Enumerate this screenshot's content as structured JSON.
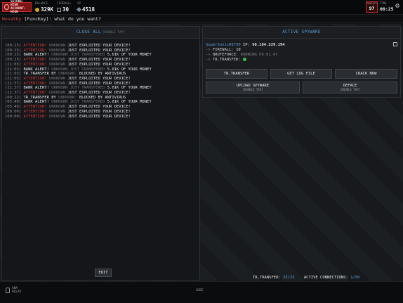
{
  "topbar": {
    "secure_line1": "SECURE: HIGH",
    "secure_line2": "ACCOUNT: HIGH",
    "balance_label": "BALANCE",
    "balance_value": "329K",
    "firewall_label": "FIREWALL",
    "firewall_value": "30",
    "xp_label": "XP",
    "xp_value": "4518",
    "credits_label": "CREDITS",
    "credits_value": "97",
    "time_label": "TIME",
    "time_value": "00:25"
  },
  "chat": {
    "user": "NovaSky",
    "handle": "[FuncKey]:",
    "message": "what do you want?"
  },
  "log_panel": {
    "title": "CLOSE ALL",
    "title_sub": "[DOUBLE TAP]",
    "lines": [
      {
        "t": "[00:25]",
        "a": "ATTENTION!",
        "g": "UNKNOWN",
        "w": "JUST EXPLOITED YOUR DEVICE!"
      },
      {
        "t": "[00:25]",
        "a": "ATTENTION!",
        "g": "UNKNOWN",
        "w": "JUST EXPLOITED YOUR DEVICE!"
      },
      {
        "t": "[00:25]",
        "w": "BANK ALERT!",
        "g": "UNKNOWN JUST TRANSFERED",
        "w2": "5.61K OF YOUR MONEY"
      },
      {
        "t": "[00:25]",
        "a": "ATTENTION!",
        "g": "UNKNOWN",
        "w": "JUST EXPLOITED YOUR DEVICE!"
      },
      {
        "t": "[21:03]",
        "a": "ATTENTION!",
        "g": "UNKNOWN",
        "w": "JUST EXPLOITED YOUR DEVICE!"
      },
      {
        "t": "[21:03]",
        "w": "BANK ALERT!",
        "g": "UNKNOWN JUST TRANSFERED",
        "w2": "5.01K OF YOUR MONEY"
      },
      {
        "t": "[21:03]",
        "w": "TR.TRANSFER BY",
        "g": "UNKNOWN:",
        "w2": "BLOCKED BY ANTIVIRUS"
      },
      {
        "t": "[21:03]",
        "a": "ATTENTION!",
        "g": "UNKNOWN",
        "w": "JUST EXPLOITED YOUR DEVICE!"
      },
      {
        "t": "[11:37]",
        "a": "ATTENTION!",
        "g": "UNKNOWN",
        "w": "JUST EXPLOITED YOUR DEVICE!"
      },
      {
        "t": "[11:37]",
        "w": "BANK ALERT!",
        "g": "UNKNOWN JUST TRANSFERED",
        "w2": "5.01K OF YOUR MONEY"
      },
      {
        "t": "[11:37]",
        "a": "ATTENTION!",
        "g": "UNKNOWN",
        "w": "JUST EXPLOITED YOUR DEVICE!"
      },
      {
        "t": "[09:22]",
        "w": "TR.TRANSFER BY",
        "g": "UNKNOWN:",
        "w2": "BLOCKED BY ANTIVIRUS"
      },
      {
        "t": "[05:40]",
        "w": "BANK ALERT!",
        "g": "UNKNOWN JUST TRANSFERED",
        "w2": "5.01K OF YOUR MONEY"
      },
      {
        "t": "[05:40]",
        "a": "ATTENTION!",
        "g": "UNKNOWN",
        "w": "JUST EXPLOITED YOUR DEVICE!"
      },
      {
        "t": "[00:00]",
        "a": "ATTENTION!",
        "g": "UNKNOWN",
        "w": "JUST EXPLOITED YOUR DEVICE!"
      },
      {
        "t": "[00:00]",
        "a": "ATTENTION!",
        "g": "UNKNOWN",
        "w": "JUST EXPLOITED YOUR DEVICE!"
      }
    ],
    "edit_label": "EDIT"
  },
  "spyware_panel": {
    "title": "ACTIVE SPYWARE",
    "user": "SuperSonic#3730",
    "ip_label": "IP:",
    "ip_value": "98.184.229.194",
    "firewall_key": "FIREWALL:",
    "firewall_val": "10",
    "bruteforce_key": "BRUTEFORCE:",
    "bruteforce_val": "RUNNING 00:01:47",
    "trtransfer_key": "TR.TRANSFER:",
    "buttons": {
      "tr_transfer": "TR.TRANSFER",
      "get_log": "GET LOG FILE",
      "crack": "CRACK NOW",
      "upload": "UPLOAD SPYWARE",
      "upload_sub": "[DOUBLE TAP]",
      "deface": "DEFACE",
      "deface_sub": "[DOUBLE TAP]"
    }
  },
  "status": {
    "tr_label": "TR.TRANSFER:",
    "tr_value": "25/25",
    "conn_label": "ACTIVE CONNECTIONS:",
    "conn_value": "1/50"
  },
  "bottombar": {
    "line1": "ANA",
    "line2": "RELAY",
    "center": "HIDE"
  }
}
